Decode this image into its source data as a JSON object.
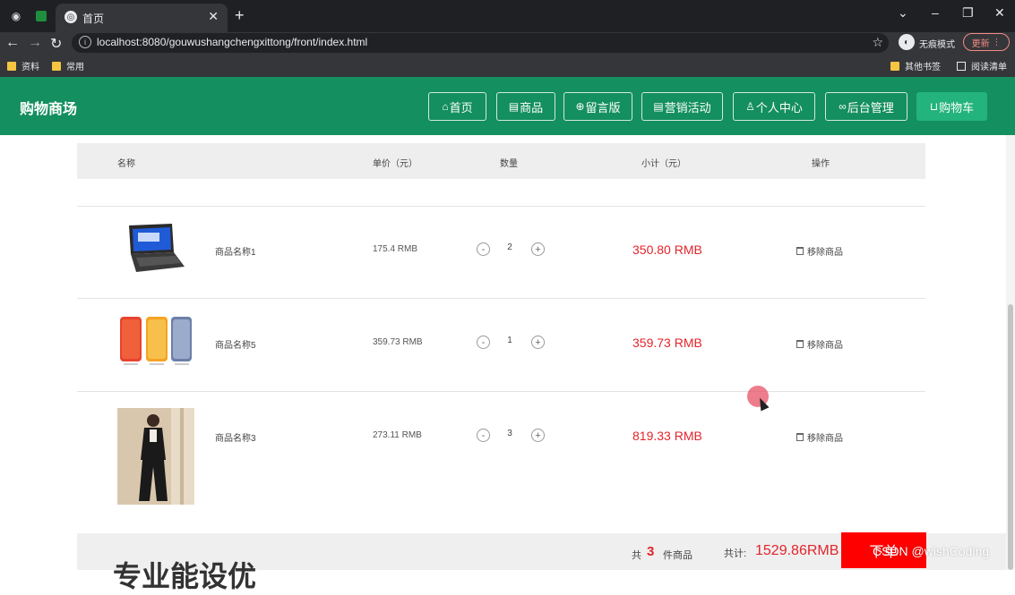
{
  "browser": {
    "tab_title": "首页",
    "url_host": "localhost:8080/gouwushangchengxittong/front/index.html",
    "incognito_label": "无痕模式",
    "update_label": "更新",
    "bookmarks": [
      "资料",
      "常用"
    ],
    "bookmarks_right": [
      "其他书签",
      "阅读清单"
    ]
  },
  "site": {
    "brand": "购物商场",
    "nav": [
      {
        "label": "首页",
        "icon": "home-icon"
      },
      {
        "label": "商品",
        "icon": "calendar-icon"
      },
      {
        "label": "留言版",
        "icon": "globe-icon"
      },
      {
        "label": "营销活动",
        "icon": "calendar-icon"
      },
      {
        "label": "个人中心",
        "icon": "user-icon"
      },
      {
        "label": "后台管理",
        "icon": "link-icon"
      },
      {
        "label": "购物车",
        "icon": "cart-icon"
      }
    ]
  },
  "cart": {
    "headers": {
      "name": "名称",
      "unit_price": "单价（元）",
      "quantity": "数量",
      "subtotal": "小计（元）",
      "action": "操作"
    },
    "items": [
      {
        "name": "商品名称1",
        "price": "175.4 RMB",
        "qty": "2",
        "subtotal": "350.80 RMB",
        "remove": "移除商品",
        "image": "laptop"
      },
      {
        "name": "商品名称5",
        "price": "359.73 RMB",
        "qty": "1",
        "subtotal": "359.73 RMB",
        "remove": "移除商品",
        "image": "phones"
      },
      {
        "name": "商品名称3",
        "price": "273.11 RMB",
        "qty": "3",
        "subtotal": "819.33 RMB",
        "remove": "移除商品",
        "image": "woman-suit"
      }
    ],
    "footer": {
      "prefix": "共",
      "count": "3",
      "suffix": "件商品",
      "total_label": "共计:",
      "total": "1529.86RMB",
      "order_button": "下单"
    }
  },
  "partial_text": "专业能设优",
  "watermark": "CSDN @wishCoding",
  "colors": {
    "header_green": "#148f5f",
    "price_red": "#e3242b",
    "order_red": "#ff0000"
  }
}
